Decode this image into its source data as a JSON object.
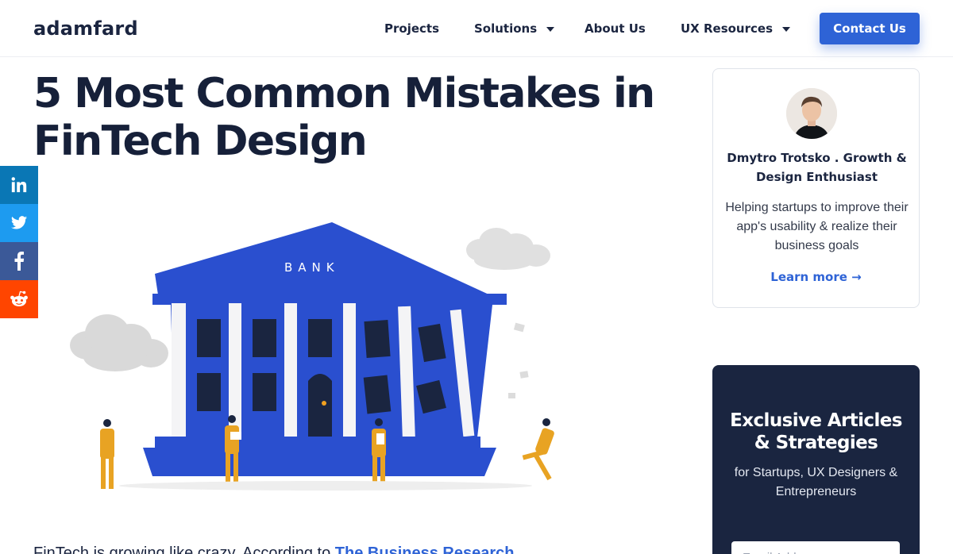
{
  "header": {
    "logo": "adamfard",
    "nav": [
      {
        "label": "Projects",
        "has_dropdown": false
      },
      {
        "label": "Solutions",
        "has_dropdown": true
      },
      {
        "label": "About Us",
        "has_dropdown": false
      },
      {
        "label": "UX Resources",
        "has_dropdown": true
      }
    ],
    "cta_label": "Contact Us"
  },
  "article": {
    "title_line1": "5 Most Common Mistakes in",
    "title_line2": "FinTech Design",
    "illustration": {
      "sign_text": "BANK",
      "icon": "bank-illustration"
    },
    "intro_text": "FinTech is growing like crazy. According to ",
    "intro_link": "The Business Research"
  },
  "social": [
    {
      "network": "linkedin",
      "icon": "linkedin-icon",
      "color": "#0a77b5"
    },
    {
      "network": "twitter",
      "icon": "twitter-icon",
      "color": "#1d9bf0"
    },
    {
      "network": "facebook",
      "icon": "facebook-icon",
      "color": "#3b5998"
    },
    {
      "network": "reddit",
      "icon": "reddit-icon",
      "color": "#ff4500"
    }
  ],
  "author_card": {
    "name": "Dmytro Trotsko . Growth & Design Enthusiast",
    "bio": "Helping startups to improve their app's usability & realize their business goals",
    "link_label": "Learn more →"
  },
  "newsletter": {
    "title": "Exclusive Articles & Strategies",
    "subtitle": "for Startups, UX Designers & Entrepreneurs",
    "input_placeholder": "Email Address"
  },
  "colors": {
    "accent": "#2e63d6",
    "text_dark": "#162039",
    "newsletter_bg": "#1a2540",
    "bank_blue": "#2a4fcf"
  }
}
